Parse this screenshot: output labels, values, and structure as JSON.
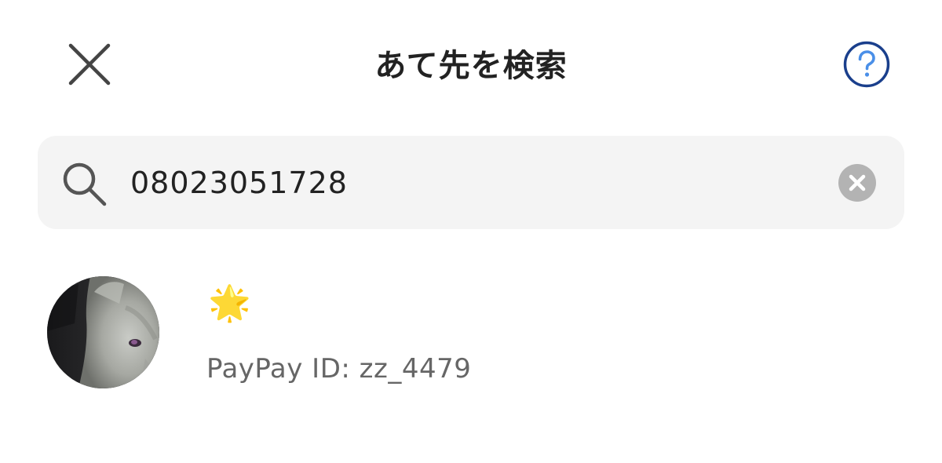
{
  "header": {
    "title": "あて先を検索",
    "close_icon": "close-icon",
    "help_icon": "question-circle-icon",
    "help_color": "#1a3f8c"
  },
  "search": {
    "value": "08023051728",
    "search_icon": "magnifier-icon",
    "clear_icon": "clear-circle-icon"
  },
  "results": [
    {
      "name": "🌟",
      "id_label": "PayPay ID: zz_4479",
      "avatar_icon": "cat-avatar"
    }
  ],
  "colors": {
    "background": "#ffffff",
    "search_bg": "#f4f4f4",
    "text_primary": "#222222",
    "text_secondary": "#666666"
  }
}
